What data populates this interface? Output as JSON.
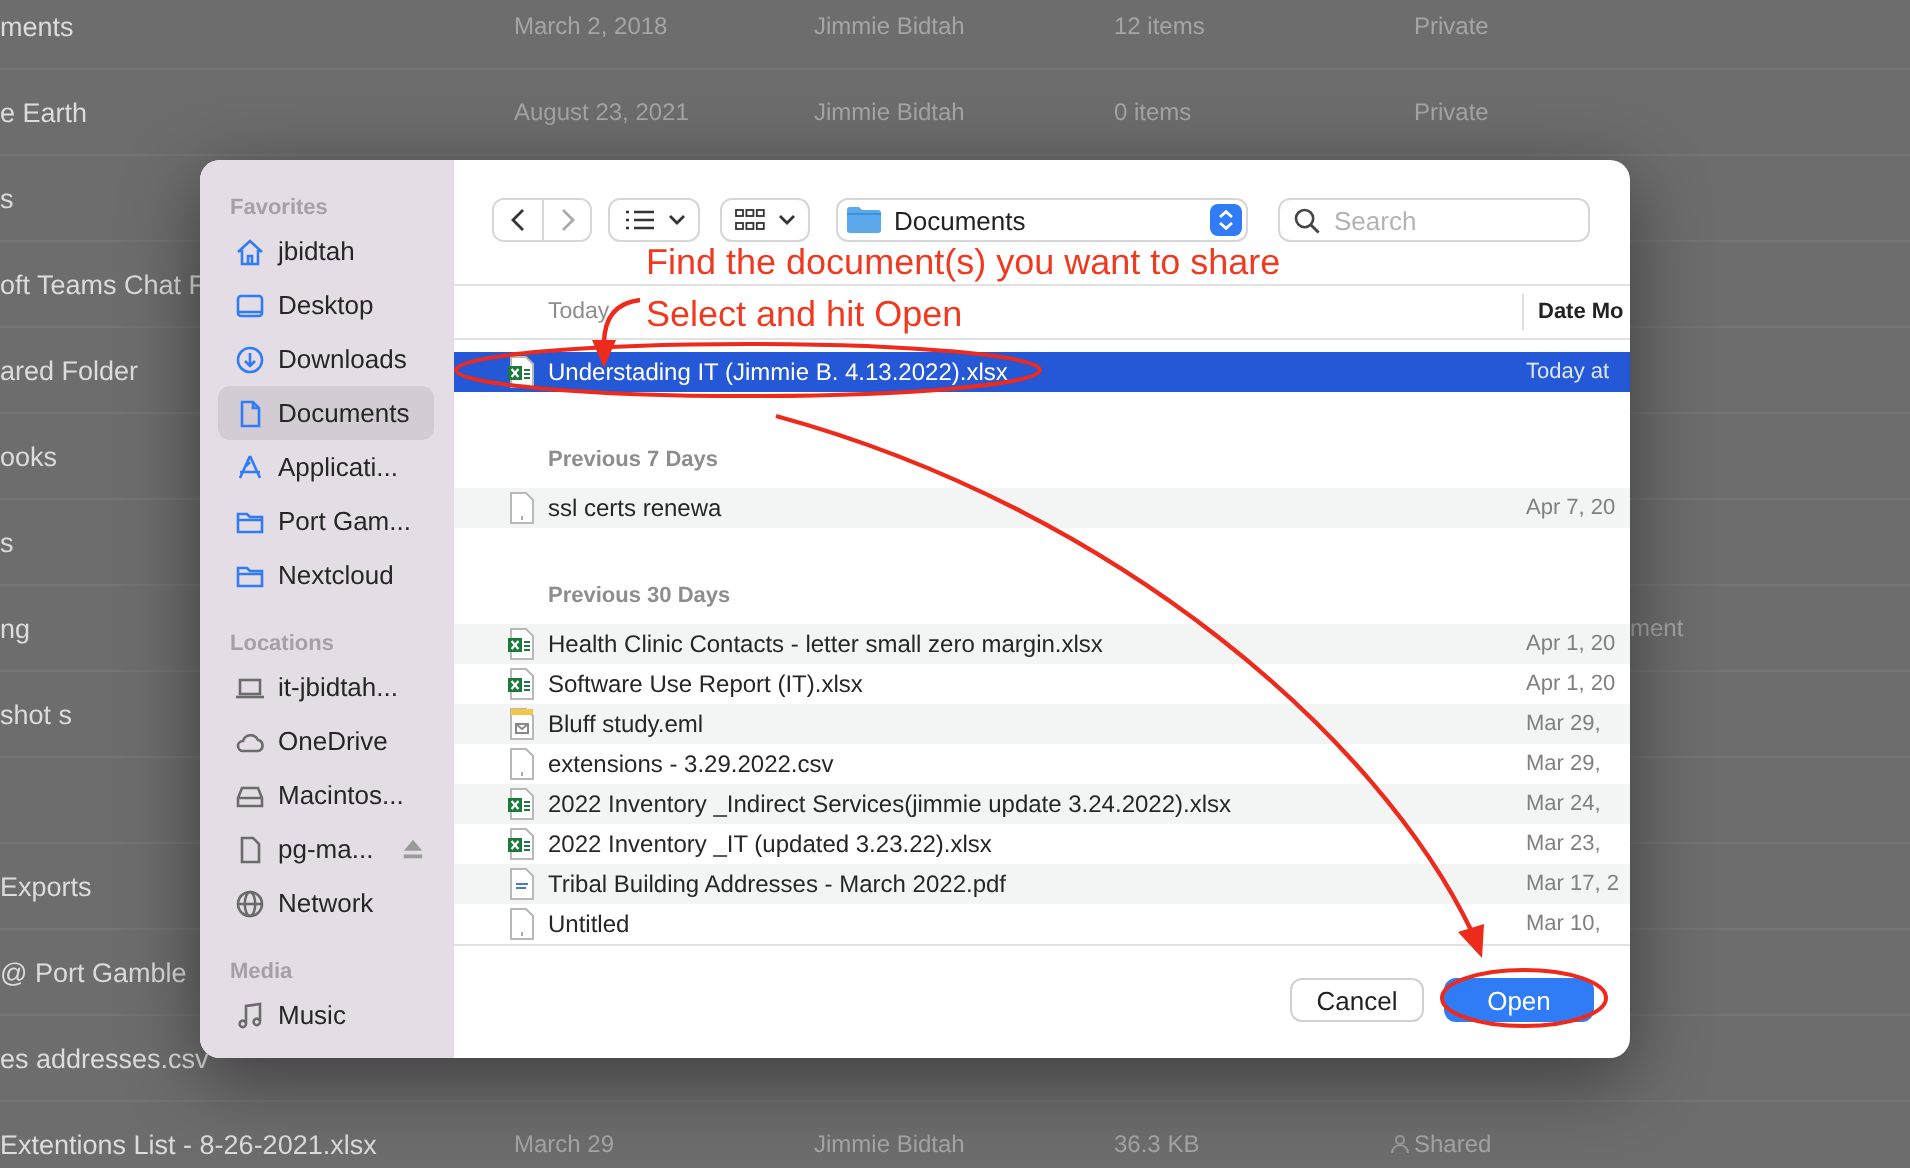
{
  "background_list": {
    "rows": [
      {
        "name": "ments",
        "date": "March 2, 2018",
        "owner": "Jimmie Bidtah",
        "size": "12 items",
        "sharing": "Private",
        "shared": false
      },
      {
        "name": "e Earth",
        "date": "August 23, 2021",
        "owner": "Jimmie Bidtah",
        "size": "0 items",
        "sharing": "Private",
        "shared": false
      },
      {
        "name": "s"
      },
      {
        "name": "oft Teams Chat F"
      },
      {
        "name": "ared Folder"
      },
      {
        "name": "ooks"
      },
      {
        "name": "s"
      },
      {
        "name": "ng",
        "column_6": "ment"
      },
      {
        "name": "shot s"
      },
      {},
      {
        "name": "Exports"
      },
      {
        "name": "@ Port Gamble"
      },
      {
        "name": "es addresses.csv"
      },
      {
        "name": "Extentions List - 8-26-2021.xlsx",
        "date": "March 29",
        "owner": "Jimmie Bidtah",
        "size": "36.3 KB",
        "sharing": "Shared",
        "shared": true
      }
    ]
  },
  "dialog": {
    "sidebar": {
      "sections": [
        {
          "title": "Favorites",
          "items": [
            {
              "label": "jbidtah",
              "kind": "home",
              "selected": false
            },
            {
              "label": "Desktop",
              "kind": "desktop",
              "selected": false
            },
            {
              "label": "Downloads",
              "kind": "download",
              "selected": false
            },
            {
              "label": "Documents",
              "kind": "document",
              "selected": true
            },
            {
              "label": "Applicati...",
              "kind": "apps",
              "selected": false
            },
            {
              "label": "Port Gam...",
              "kind": "folder",
              "selected": false
            },
            {
              "label": "Nextcloud",
              "kind": "folder",
              "selected": false
            }
          ]
        },
        {
          "title": "Locations",
          "items": [
            {
              "label": "it-jbidtah...",
              "kind": "laptop",
              "selected": false
            },
            {
              "label": "OneDrive",
              "kind": "cloud",
              "selected": false
            },
            {
              "label": "Macintos...",
              "kind": "disk",
              "selected": false
            },
            {
              "label": "pg-ma...",
              "kind": "file",
              "selected": false,
              "ejectable": true
            },
            {
              "label": "Network",
              "kind": "network",
              "selected": false
            }
          ]
        },
        {
          "title": "Media",
          "items": [
            {
              "label": "Music",
              "kind": "music",
              "selected": false
            }
          ]
        }
      ]
    },
    "toolbar": {
      "location": "Documents",
      "search": {
        "placeholder": "Search"
      }
    },
    "file_list": {
      "columns": [
        "Date Mo"
      ],
      "groups": [
        {
          "title": "Today",
          "files": [
            {
              "name": "Understading IT (Jimmie B. 4.13.2022).xlsx",
              "date": "Today at",
              "kind": "excel",
              "selected": true
            }
          ]
        },
        {
          "title": "Previous 7 Days",
          "files": [
            {
              "name": "ssl certs renewa",
              "date": "Apr 7, 20",
              "kind": "blank",
              "selected": false
            }
          ]
        },
        {
          "title": "Previous 30 Days",
          "files": [
            {
              "name": "Health Clinic Contacts - letter small zero margin.xlsx",
              "date": "Apr 1, 20",
              "kind": "excel",
              "selected": false
            },
            {
              "name": "Software Use Report (IT).xlsx",
              "date": "Apr 1, 20",
              "kind": "excel",
              "selected": false
            },
            {
              "name": "Bluff study.eml",
              "date": "Mar 29,",
              "kind": "mail",
              "selected": false
            },
            {
              "name": "extensions - 3.29.2022.csv",
              "date": "Mar 29,",
              "kind": "blank",
              "selected": false
            },
            {
              "name": "2022 Inventory _Indirect Services(jimmie update 3.24.2022).xlsx",
              "date": "Mar 24,",
              "kind": "excel",
              "selected": false
            },
            {
              "name": "2022 Inventory _IT (updated 3.23.22).xlsx",
              "date": "Mar 23,",
              "kind": "excel",
              "selected": false
            },
            {
              "name": "Tribal Building Addresses - March 2022.pdf",
              "date": "Mar 17, 2",
              "kind": "pdf",
              "selected": false
            },
            {
              "name": "Untitled",
              "date": "Mar 10,",
              "kind": "blank",
              "selected": false
            }
          ]
        }
      ]
    },
    "buttons": [
      {
        "label": "Cancel",
        "default": false
      },
      {
        "label": "Open",
        "default": true
      }
    ]
  },
  "annotations": [
    "Find the document(s) you want to share",
    "Select and hit Open"
  ]
}
